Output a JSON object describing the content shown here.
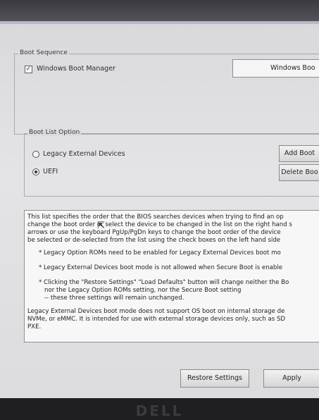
{
  "boot_sequence": {
    "title": "Boot Sequence",
    "item_label": "Windows Boot Manager",
    "item_checked": true,
    "list_value": "Windows Boo"
  },
  "boot_list_option": {
    "title": "Boot List Option",
    "legacy_label": "Legacy External Devices",
    "uefi_label": "UEFI",
    "selected": "UEFI",
    "add_button": "Add Boot",
    "delete_button": "Delete Boo"
  },
  "help": {
    "lines": [
      "This list specifies the order that the BIOS searches devices when trying to find an op",
      "change the boot order or select the device to be changed in the list on the right hand s",
      "arrows or use the keyboard PgUp/PgDn keys to change the boot order of the device",
      "be selected or de-selected from the list using the check boxes on the left hand side",
      "* Legacy Option ROMs need to be enabled for Legacy External Devices boot mo",
      "* Legacy External Devices boot mode is not allowed when Secure Boot is enable",
      "* Clicking the \"Restore Settings\" \"Load Defaults\" button will change neither the Bo",
      "nor the Legacy Option ROMs setting, nor the Secure Boot setting",
      "-- these three settings will remain unchanged.",
      "Legacy External Devices boot mode does not support OS boot on internal storage de",
      "NVMe, or eMMC. It is intended for use with external storage devices only, such as SD",
      "PXE."
    ]
  },
  "buttons": {
    "restore": "Restore Settings",
    "apply": "Apply"
  },
  "brand": "DELL"
}
